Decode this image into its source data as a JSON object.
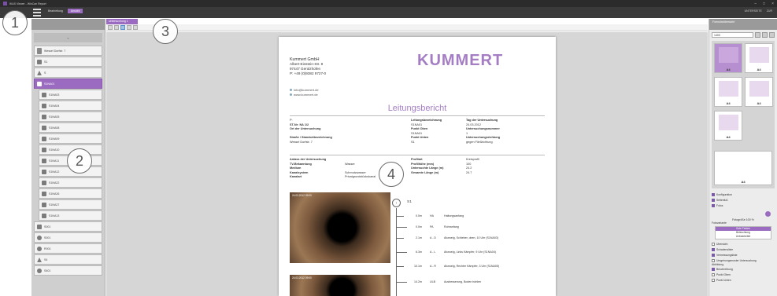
{
  "window": {
    "title": "IKAS Viewer - WinCan Report"
  },
  "ribbon": {
    "tabs": [
      "Bearbeitung",
      "Ansicht"
    ],
    "right_items": [
      "UNTERSEITE",
      "ZUR"
    ]
  },
  "callouts": [
    "1",
    "2",
    "3",
    "4"
  ],
  "left_panel": {
    "search_label": "<",
    "items": [
      {
        "label": "Wessel Dorfstr. 7",
        "icon": "doc",
        "indent": false,
        "selected": false
      },
      {
        "label": "S1",
        "icon": "pipe",
        "indent": false,
        "selected": false
      },
      {
        "label": "S",
        "icon": "tri",
        "indent": false,
        "selected": false
      },
      {
        "label": "S1NA01",
        "icon": "pipe",
        "indent": false,
        "selected": true
      },
      {
        "label": "S1NA03",
        "icon": "pipe",
        "indent": true,
        "selected": false
      },
      {
        "label": "S1NA04",
        "icon": "pipe",
        "indent": true,
        "selected": false
      },
      {
        "label": "S1NA05",
        "icon": "pipe",
        "indent": true,
        "selected": false
      },
      {
        "label": "S1NA08",
        "icon": "pipe",
        "indent": true,
        "selected": false
      },
      {
        "label": "S1NA09",
        "icon": "pipe",
        "indent": true,
        "selected": false
      },
      {
        "label": "S1NA10",
        "icon": "pipe",
        "indent": true,
        "selected": false
      },
      {
        "label": "S1NA11",
        "icon": "pipe",
        "indent": true,
        "selected": false
      },
      {
        "label": "S1NA12",
        "icon": "pipe",
        "indent": true,
        "selected": false
      },
      {
        "label": "S1NA22",
        "icon": "pipe",
        "indent": true,
        "selected": false
      },
      {
        "label": "S1NA26",
        "icon": "pipe",
        "indent": true,
        "selected": false
      },
      {
        "label": "S1NA27",
        "icon": "pipe",
        "indent": true,
        "selected": false
      },
      {
        "label": "S1NA13",
        "icon": "pipe",
        "indent": true,
        "selected": false
      },
      {
        "label": "S001",
        "icon": "pipe",
        "indent": false,
        "selected": false
      },
      {
        "label": "S001",
        "icon": "round",
        "indent": false,
        "selected": false
      },
      {
        "label": "R001",
        "icon": "round",
        "indent": false,
        "selected": false
      },
      {
        "label": "S4",
        "icon": "tri",
        "indent": false,
        "selected": false
      },
      {
        "label": "S401",
        "icon": "round",
        "indent": false,
        "selected": false
      }
    ]
  },
  "doc_tab": {
    "label": "Untersuchung 1"
  },
  "report": {
    "company": {
      "name": "Kummert GmbH",
      "street": "Albert-Einstein-Str. 8",
      "city": "97447 Gerolzhofen",
      "phone": "P: +49 (0)9382 9727-0",
      "email": "info@kummert.de",
      "web": "www.kummert.de"
    },
    "logo": "KUMMERT",
    "title": "Leitungsbericht",
    "block1": {
      "col1": [
        "P:",
        "ST-Nr: NA 1/2",
        "Ort der Untersuchung",
        "",
        "Straße / Standortbezeichnung",
        "Wessel Dorfstr. 7"
      ],
      "col2": [
        "Leitungsbezeichnung",
        "S1NA01",
        "Punkt Oben",
        "S1NA01",
        "Punkt Unten",
        "S1"
      ],
      "col3": [
        "Tag der Untersuchung",
        "24.03.2012",
        "Untersuchungsnummer",
        "1",
        "Untersuchungsrichtung",
        "gegen Fließrichtung"
      ]
    },
    "block2": {
      "labels": [
        "Anlass der Untersuchung",
        "TV-Bekanntung",
        "Medium",
        "Kanalsystem",
        "Kanalart"
      ],
      "values": [
        "",
        "Wasser",
        "",
        "Schmutzwasser",
        "Privatgrundstückskanal"
      ],
      "labels2": [
        "Profilart",
        "Profilhöhe (mm)",
        "Untersuchte Länge (m)",
        "Gesamte Länge (m)"
      ],
      "values2": [
        "Kreisprofil",
        "100",
        "24.2",
        "24.7"
      ]
    },
    "photo1_label": "24.03.2012 09:00",
    "photo2_label": "24.03.2012 09:00",
    "station": {
      "marker": "↑",
      "name": "S1"
    },
    "observations": [
      {
        "dist": "0.0m",
        "code": "HA",
        "text": "Haltungsanfang"
      },
      {
        "dist": "0.0m",
        "code": "PA",
        "text": "Rohranfang"
      },
      {
        "dist": "2.1m",
        "code": "A - D",
        "text": "Abzweig, Schieber, oben, 10 Uhr (S1NA03)"
      },
      {
        "dist": "6.3m",
        "code": "A - L",
        "text": "Abzweig, Links Kämpfer, 9 Uhr (S1NA04)"
      },
      {
        "dist": "10.1m",
        "code": "A - R",
        "text": "Abzweig, Rechter Kämpfer, 3 Uhr (S1NA05)"
      },
      {
        "dist": "14.2m",
        "code": "ULB",
        "text": "Ausbesserung, Boden bohlen"
      }
    ]
  },
  "right_panel": {
    "header": "Formularübersicht",
    "select_value": "1400",
    "thumb_label": "A4",
    "options": {
      "checks": [
        "Konfiguration",
        "Seitenfuß",
        "Fotos"
      ],
      "percent_label": "Fotogröße 100 %",
      "choice_title": "Fotovariante",
      "choices": [
        "Gute Farben",
        "Beleuchtung",
        "Unbearbeitet"
      ],
      "checks2": [
        "Übersicht",
        "Schadensliste",
        "Vermessungsliste",
        "Umgehungsmuster Untersuchung"
      ],
      "section": "Abbildung",
      "checks3": [
        "Beschreibung",
        "Punkt Oben",
        "Punkt Unten"
      ]
    }
  },
  "colors": {
    "accent": "#9b6bc1",
    "logo": "#a47dc3"
  }
}
